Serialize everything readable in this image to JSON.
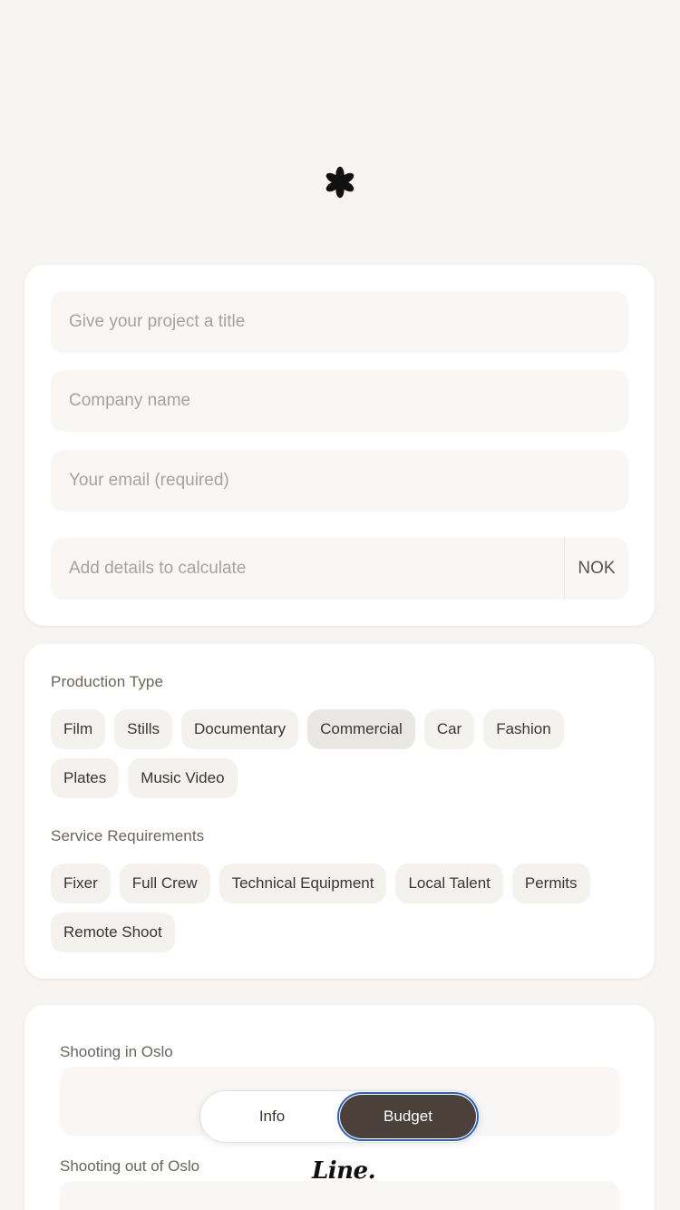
{
  "icons": {
    "logo": "asterisk-flower-icon"
  },
  "colors": {
    "background": "#f6f5f3",
    "card": "#ffffff",
    "field": "#f8f7f5",
    "chip": "#f4f2ef",
    "chip_selected": "#e9e7e4",
    "toggle_active": "#4b403a",
    "focus_ring": "#2563c9"
  },
  "form": {
    "title_placeholder": "Give your project a title",
    "company_placeholder": "Company name",
    "email_placeholder": "Your email (required)",
    "budget_placeholder": "Add details to calculate",
    "currency": "NOK"
  },
  "production": {
    "label": "Production Type",
    "options": [
      "Film",
      "Stills",
      "Documentary",
      "Commercial",
      "Car",
      "Fashion",
      "Plates",
      "Music Video"
    ],
    "selected": "Commercial"
  },
  "services": {
    "label": "Service Requirements",
    "options": [
      "Fixer",
      "Full Crew",
      "Technical Equipment",
      "Local Talent",
      "Permits",
      "Remote Shoot"
    ]
  },
  "location": {
    "in_oslo_label": "Shooting in Oslo",
    "out_oslo_label": "Shooting out of Oslo"
  },
  "toggle": {
    "info_label": "Info",
    "budget_label": "Budget",
    "active": "Budget"
  },
  "brand": {
    "wordmark": "Line."
  }
}
